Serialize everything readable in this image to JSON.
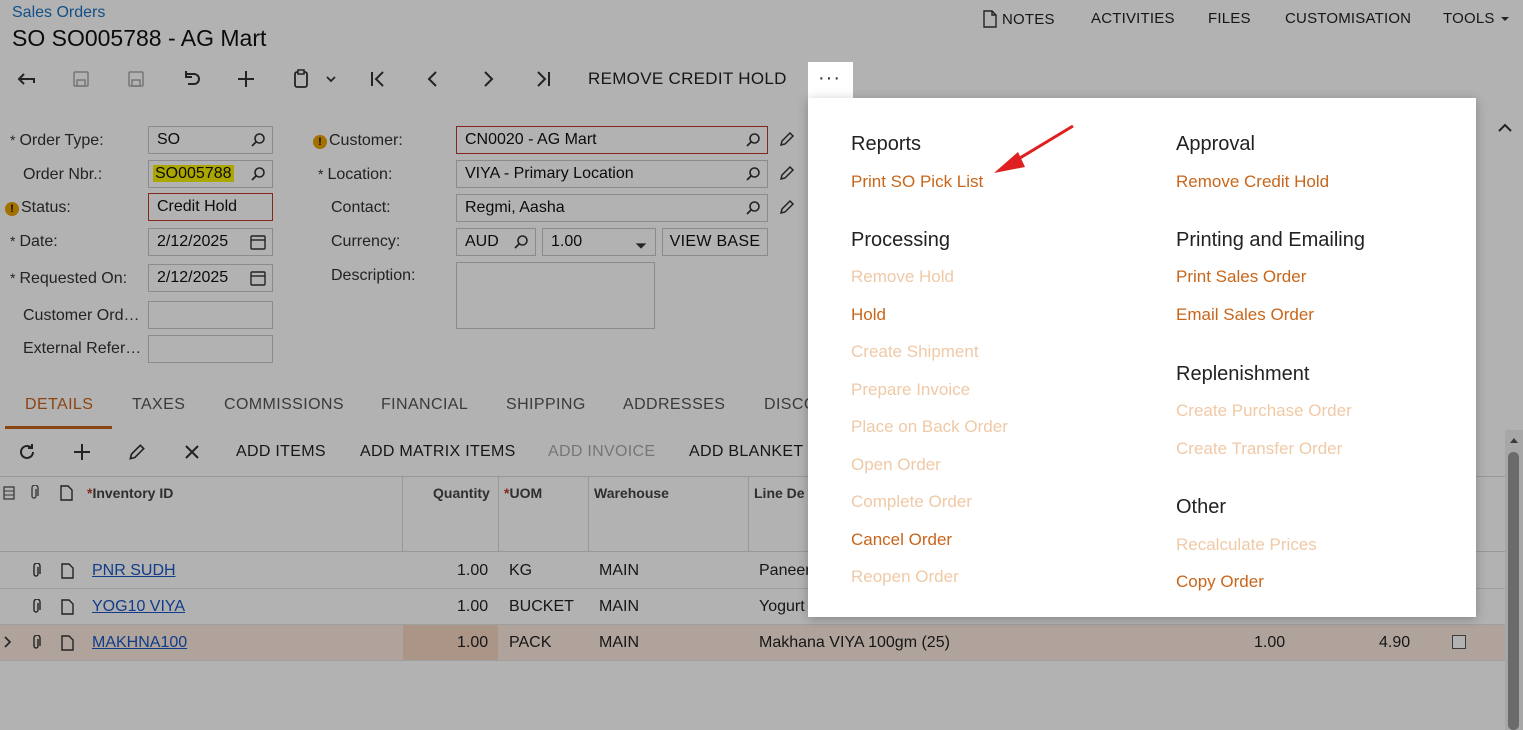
{
  "header": {
    "breadcrumb": "Sales Orders",
    "title": "SO SO005788 - AG Mart",
    "menu": {
      "notes": "NOTES",
      "activities": "ACTIVITIES",
      "files": "FILES",
      "customisation": "CUSTOMISATION",
      "tools": "TOOLS"
    }
  },
  "toolbar": {
    "remove_credit_hold": "REMOVE CREDIT HOLD",
    "more": "···"
  },
  "form": {
    "order_type": {
      "label": "Order Type:",
      "value": "SO"
    },
    "order_nbr": {
      "label": "Order Nbr.:",
      "value": "SO005788"
    },
    "status": {
      "label": "Status:",
      "value": "Credit Hold"
    },
    "date": {
      "label": "Date:",
      "value": "2/12/2025"
    },
    "requested_on": {
      "label": "Requested On:",
      "value": "2/12/2025"
    },
    "customer_order": {
      "label": "Customer Ord…",
      "value": ""
    },
    "external_ref": {
      "label": "External Refer…",
      "value": ""
    },
    "customer": {
      "label": "Customer:",
      "value": "CN0020 - AG Mart"
    },
    "location": {
      "label": "Location:",
      "value": "VIYA - Primary Location"
    },
    "contact": {
      "label": "Contact:",
      "value": "Regmi, Aasha"
    },
    "currency": {
      "label": "Currency:",
      "value": "AUD",
      "rate": "1.00",
      "view_base": "VIEW BASE"
    },
    "description": {
      "label": "Description:",
      "value": ""
    }
  },
  "tabs": [
    "DETAILS",
    "TAXES",
    "COMMISSIONS",
    "FINANCIAL",
    "SHIPPING",
    "ADDRESSES",
    "DISCO"
  ],
  "grid_toolbar": {
    "add_items": "ADD ITEMS",
    "add_matrix_items": "ADD MATRIX ITEMS",
    "add_invoice": "ADD INVOICE",
    "add_blanket": "ADD BLANKET S"
  },
  "grid": {
    "headers": {
      "inventory_id": "Inventory ID",
      "quantity": "Quantity",
      "uom": "UOM",
      "warehouse": "Warehouse",
      "line_desc": "Line De"
    },
    "rows": [
      {
        "inventory_id": "PNR SUDH",
        "quantity": "1.00",
        "uom": "KG",
        "warehouse": "MAIN",
        "desc": "Paneer"
      },
      {
        "inventory_id": "YOG10 VIYA",
        "quantity": "1.00",
        "uom": "BUCKET",
        "warehouse": "MAIN",
        "desc": "Yogurt"
      },
      {
        "inventory_id": "MAKHNA100",
        "quantity": "1.00",
        "uom": "PACK",
        "warehouse": "MAIN",
        "desc": "Makhana VIYA 100gm (25)",
        "extra1": "1.00",
        "extra2": "4.90"
      }
    ]
  },
  "dropdown": {
    "reports": {
      "title": "Reports",
      "items": [
        "Print SO Pick List"
      ]
    },
    "processing": {
      "title": "Processing",
      "items": [
        "Remove Hold",
        "Hold",
        "Create Shipment",
        "Prepare Invoice",
        "Place on Back Order",
        "Open Order",
        "Complete Order",
        "Cancel Order",
        "Reopen Order"
      ]
    },
    "approval": {
      "title": "Approval",
      "items": [
        "Remove Credit Hold"
      ]
    },
    "printing": {
      "title": "Printing and Emailing",
      "items": [
        "Print Sales Order",
        "Email Sales Order"
      ]
    },
    "replenishment": {
      "title": "Replenishment",
      "items": [
        "Create Purchase Order",
        "Create Transfer Order"
      ]
    },
    "other": {
      "title": "Other",
      "items": [
        "Recalculate Prices",
        "Copy Order"
      ]
    }
  },
  "colors": {
    "accent": "#c8661b",
    "accent_disabled": "#f0c9a6",
    "link": "#1a56c4",
    "highlight": "#f6f000",
    "annotation_arrow": "#e02020"
  }
}
